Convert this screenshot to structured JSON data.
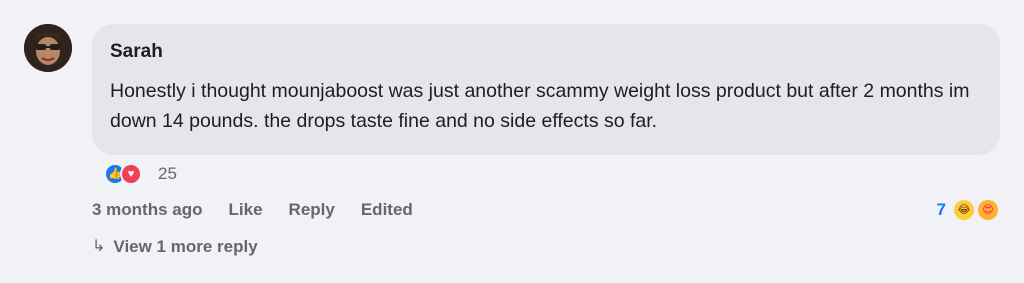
{
  "comment": {
    "author": "Sarah",
    "text": "Honestly i thought mounjaboost was just another scammy weight loss product but after 2 months im down 14 pounds. the drops taste fine and no side effects so far.",
    "reactions": {
      "icons": [
        "like-icon",
        "love-icon"
      ],
      "count": "25"
    },
    "actions": {
      "timestamp": "3 months ago",
      "like": "Like",
      "reply": "Reply",
      "edited": "Edited"
    },
    "right_reactions": {
      "count": "7",
      "icons": [
        "laughing-emoji-icon",
        "heart-eyes-emoji-icon"
      ]
    },
    "more_replies": {
      "arrow": "↳",
      "label": "View 1 more reply"
    }
  },
  "colors": {
    "background": "#f0f2f5",
    "bubble": "#e4e6eb",
    "text": "#1c1e21",
    "secondary_text": "#65676b",
    "accent": "#1877f2",
    "love": "#f33e58"
  }
}
